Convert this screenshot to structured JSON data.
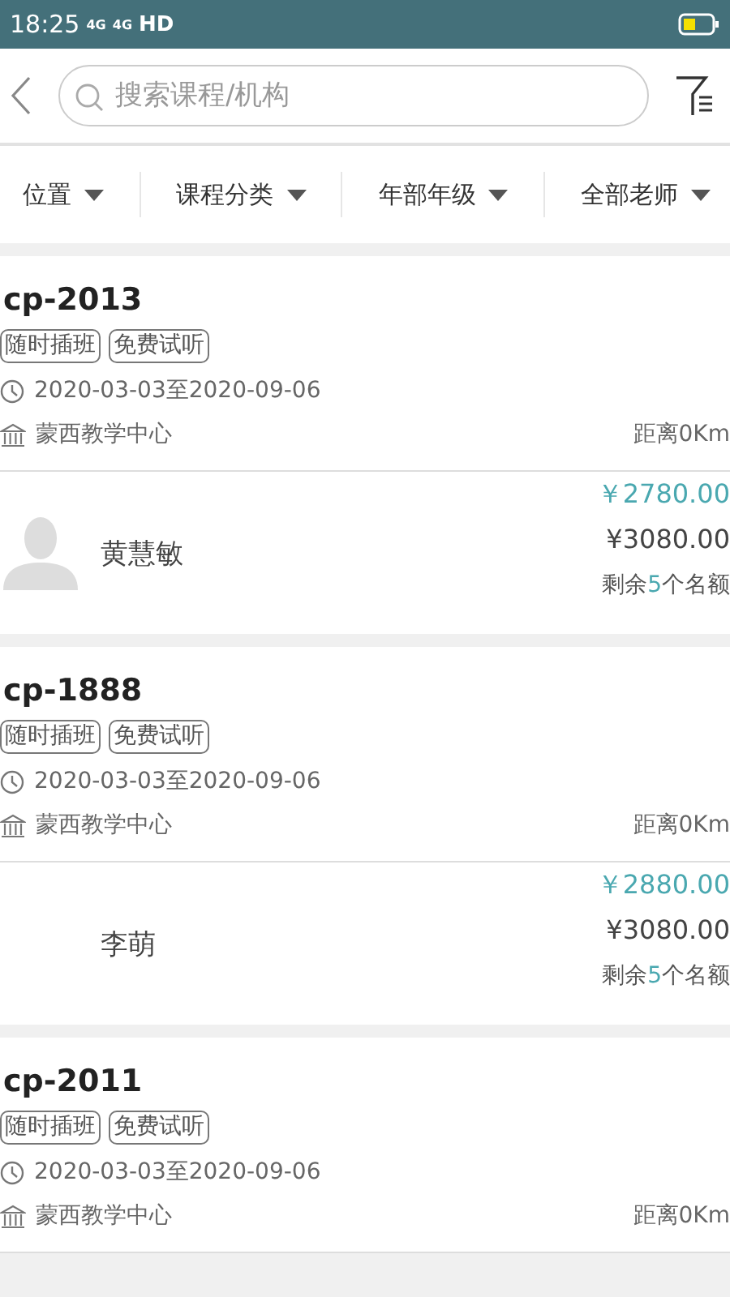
{
  "status_bar": {
    "time": "18:25",
    "networks": [
      "4G",
      "4G"
    ],
    "hd": "HD"
  },
  "search": {
    "placeholder": "搜索课程/机构"
  },
  "filters": [
    {
      "label": "位置"
    },
    {
      "label": "课程分类"
    },
    {
      "label": "年部年级"
    },
    {
      "label": "全部老师"
    }
  ],
  "courses": [
    {
      "title": "cp-2013",
      "tags": [
        "随时插班",
        "免费试听"
      ],
      "dates": "2020-03-03至2020-09-06",
      "center": "蒙西教学中心",
      "distance": "距离0Km",
      "teacher": {
        "name": "黄慧敏",
        "avatar": true,
        "price": "￥2780.00",
        "original_price": "¥3080.00",
        "remaining": "剩余**5**个名额"
      }
    },
    {
      "title": "cp-1888",
      "tags": [
        "随时插班",
        "免费试听"
      ],
      "dates": "2020-03-03至2020-09-06",
      "center": "蒙西教学中心",
      "distance": "距离0Km",
      "teacher": {
        "name": "李萌",
        "avatar": false,
        "price": "￥2880.00",
        "original_price": "¥3080.00",
        "remaining": "剩余**5**个名额"
      }
    },
    {
      "title": "cp-2011",
      "tags": [
        "随时插班",
        "免费试听"
      ],
      "dates": "2020-03-03至2020-09-06",
      "center": "蒙西教学中心",
      "distance": "距离0Km"
    }
  ]
}
